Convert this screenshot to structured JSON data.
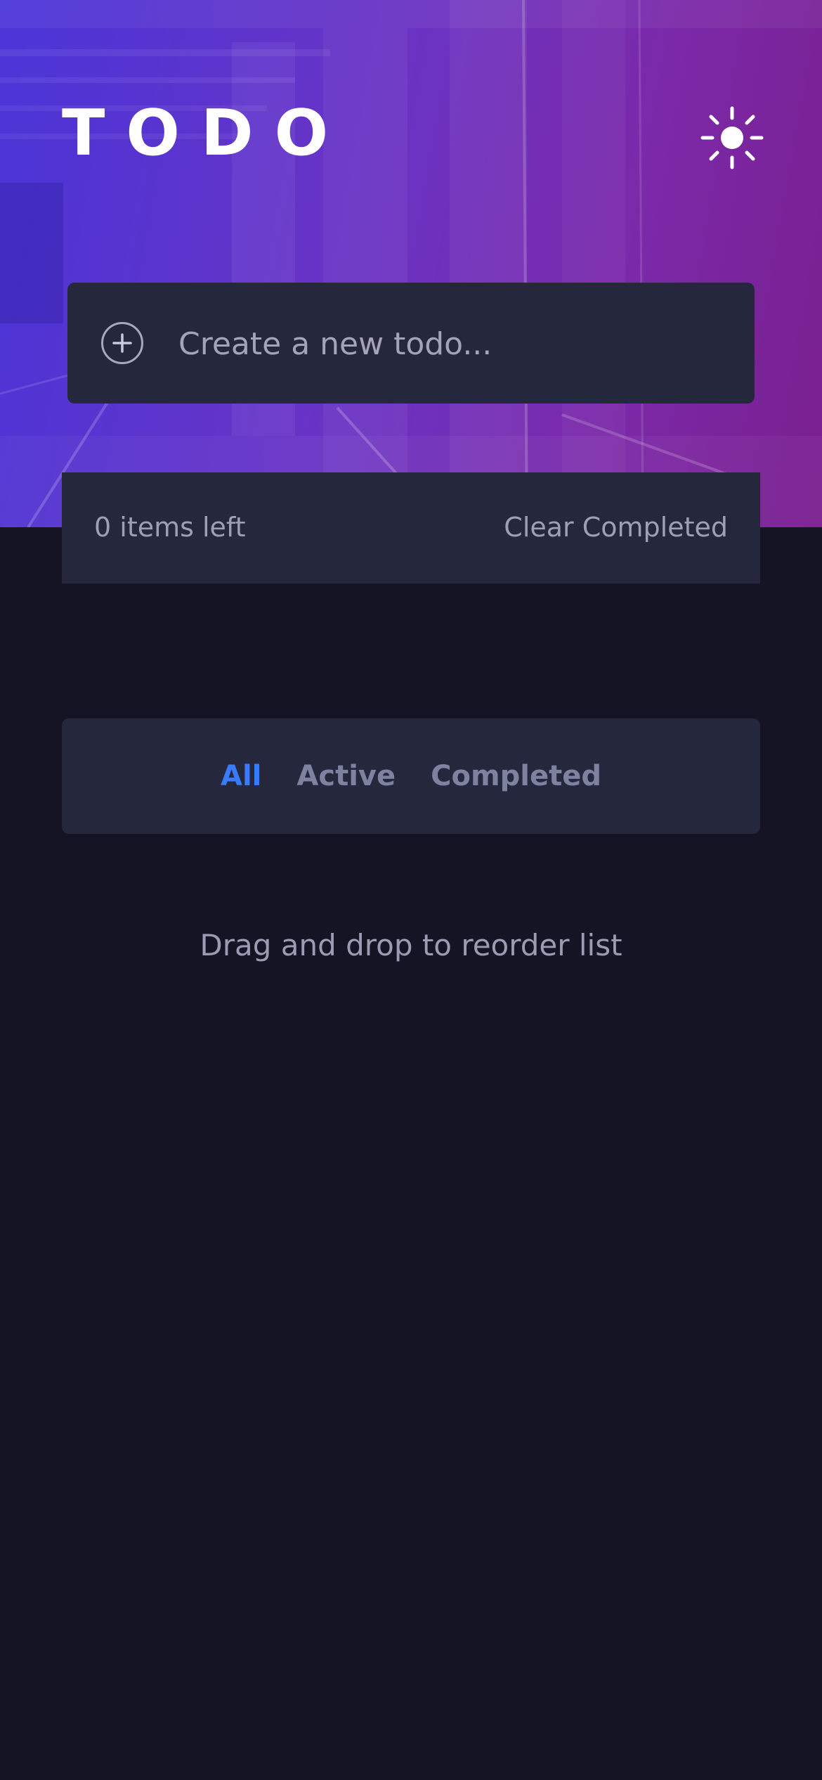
{
  "header": {
    "title": "TODO",
    "theme_toggle_icon": "sun-icon"
  },
  "new_todo": {
    "add_icon": "plus-circle-icon",
    "placeholder": "Create a new todo...",
    "value": ""
  },
  "list_footer": {
    "items_left": "0 items left",
    "clear_completed": "Clear Completed"
  },
  "filters": [
    {
      "label": "All",
      "active": true
    },
    {
      "label": "Active",
      "active": false
    },
    {
      "label": "Completed",
      "active": false
    }
  ],
  "hint": "Drag and drop to reorder list",
  "colors": {
    "page_background": "#141425",
    "card_background": "#25273c",
    "accent": "#3a7bfd",
    "muted_text": "#a7a8bd",
    "hero_gradient_start": "#4a35d8",
    "hero_gradient_end": "#7a1f8f"
  }
}
